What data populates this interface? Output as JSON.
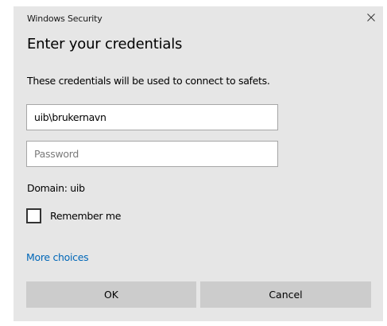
{
  "window": {
    "title": "Windows Security",
    "close_icon": "close-icon"
  },
  "dialog": {
    "heading": "Enter your credentials",
    "description": "These credentials will be used to connect to safets.",
    "username_value": "uib\\brukernavn",
    "password_placeholder": "Password",
    "domain_text": "Domain: uib",
    "remember_label": "Remember me",
    "remember_checked": false,
    "more_choices_label": "More choices",
    "ok_label": "OK",
    "cancel_label": "Cancel"
  },
  "colors": {
    "dialog_background": "#e6e6e6",
    "link": "#0067b8",
    "button_background": "#cccccc"
  }
}
